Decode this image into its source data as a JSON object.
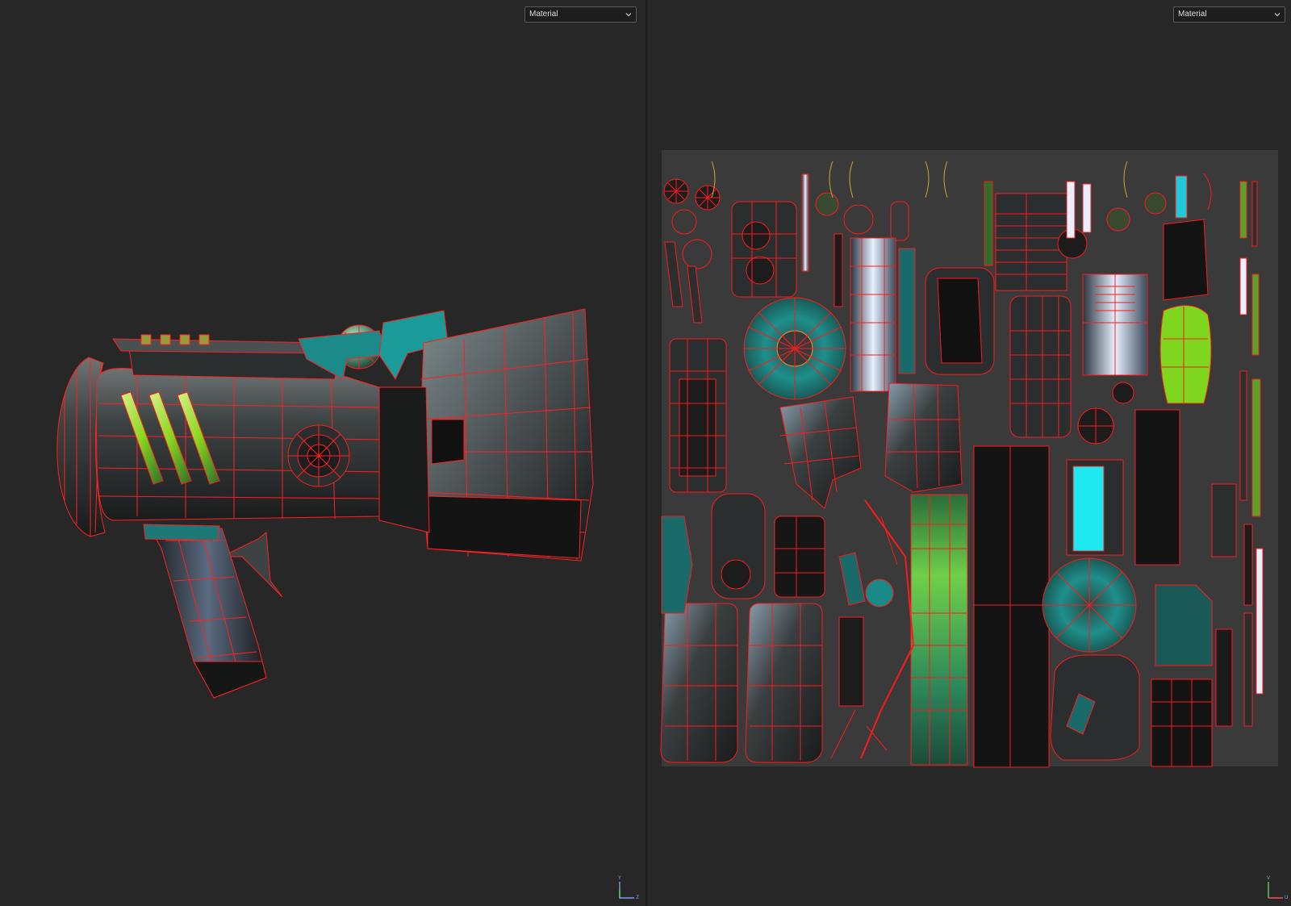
{
  "viewport_3d": {
    "material_select": {
      "value": "Material"
    },
    "axis_gizmo": {
      "up_label": "Y",
      "side_label": "Z"
    }
  },
  "viewport_uv": {
    "material_select": {
      "value": "Material"
    },
    "axis_gizmo": {
      "up_label": "V",
      "side_label": "U"
    }
  },
  "colors": {
    "background": "#272727",
    "wireframe": "#ff1a1a",
    "metal": "#3a3f40",
    "teal": "#1e8f8c",
    "lime": "#8ad61e",
    "cyan": "#20e8f0",
    "uv_canvas": "#3a3a3a"
  }
}
